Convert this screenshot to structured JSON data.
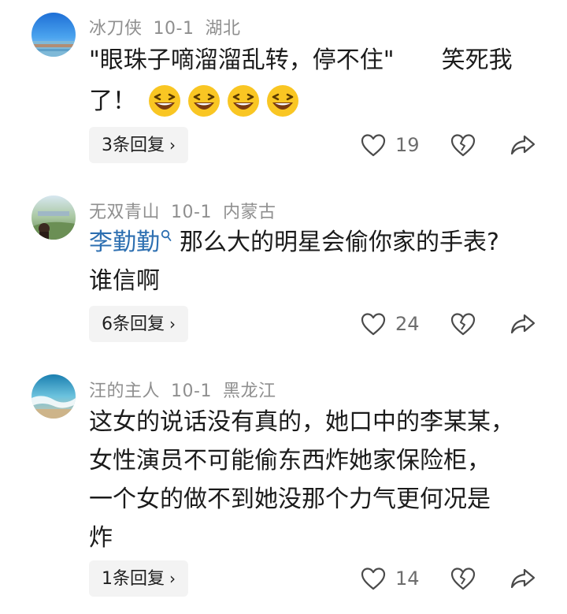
{
  "comments": [
    {
      "username": "冰刀侠",
      "date": "10-1",
      "location": "湖北",
      "text_line1": "\"眼珠子嘀溜溜乱转，停不住\"　　笑死我",
      "text_line2": "了！",
      "emoji_count": 4,
      "reply_label": "3条回复",
      "likes": "19"
    },
    {
      "username": "无双青山",
      "date": "10-1",
      "location": "内蒙古",
      "mention": "李勤勤",
      "text_line1": "那么大的明星会偷你家的手表?",
      "text_line2": "谁信啊",
      "reply_label": "6条回复",
      "likes": "24"
    },
    {
      "username": "汪的主人",
      "date": "10-1",
      "location": "黑龙江",
      "text_lines": [
        "这女的说话没有真的，她口中的李某某，",
        "女性演员不可能偷东西炸她家保险柜，",
        "一个女的做不到她没那个力气更何况是",
        "炸"
      ],
      "reply_label": "1条回复",
      "likes": "14"
    }
  ],
  "icons": {
    "like": "heart-outline-icon",
    "dislike": "broken-heart-icon",
    "share": "share-arrow-icon",
    "emoji": "laughing-face-emoji"
  },
  "colors": {
    "mention": "#2d6fb1",
    "meta": "#8f8f8f",
    "button_bg": "#f3f3f3"
  }
}
